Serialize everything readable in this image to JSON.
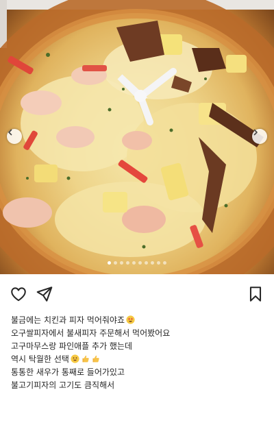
{
  "post": {
    "media": {
      "image_description": "Close-up of a pizza with shrimp, crab sticks, pineapple, bulgogi beef and melted cheese in a box",
      "carousel": {
        "total": 10,
        "active_index": 0
      },
      "prev_icon": "chevron-left-icon",
      "next_icon": "chevron-right-icon"
    },
    "actions": {
      "like_icon": "heart-outline-icon",
      "share_icon": "paper-plane-icon",
      "save_icon": "bookmark-outline-icon"
    },
    "caption": {
      "lines": [
        {
          "text": "불금에는 치킨과 피자 먹어줘야죠",
          "emojis": [
            "star-struck-emoji"
          ]
        },
        {
          "text": "오구쌀피자에서 불새피자 주문해서 먹어봤어요",
          "emojis": []
        },
        {
          "text": "고구마무스랑 파인애플 추가 했는데",
          "emojis": []
        },
        {
          "text": "역시 탁월한 선택",
          "emojis": [
            "grinning-emoji",
            "thumbs-up-emoji",
            "thumbs-up-emoji"
          ]
        },
        {
          "text": "통통한 새우가 통째로 들어가있고",
          "emojis": []
        },
        {
          "text": "불고기피자의 고기도 큼직해서",
          "emojis": []
        }
      ]
    }
  }
}
